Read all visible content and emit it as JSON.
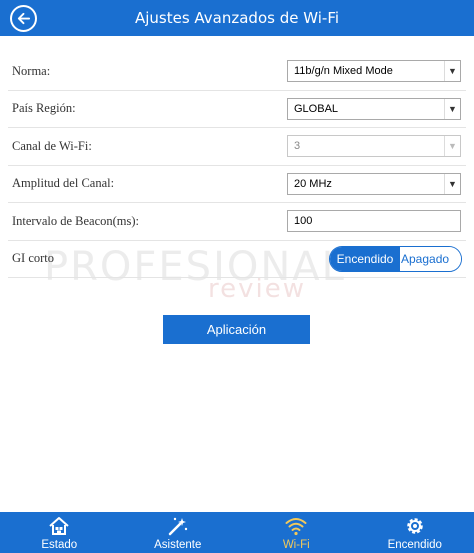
{
  "header": {
    "title": "Ajustes Avanzados de Wi-Fi",
    "back_icon": "back-arrow-icon"
  },
  "form": {
    "mode": {
      "label": "Norma:",
      "value": "11b/g/n Mixed Mode"
    },
    "region": {
      "label": "País Región:",
      "value": "GLOBAL"
    },
    "channel": {
      "label": "Canal de Wi-Fi:",
      "value": "3"
    },
    "bandwidth": {
      "label": "Amplitud del Canal:",
      "value": "20 MHz"
    },
    "beacon": {
      "label": "Intervalo de Beacon(ms):",
      "value": "100"
    },
    "gi": {
      "label": "GI corto",
      "on_label": "Encendido",
      "off_label": "Apagado",
      "selected": "Encendido"
    }
  },
  "watermark": {
    "line1": "PROFESIONAL",
    "line2": "review"
  },
  "apply_label": "Aplicación",
  "nav": {
    "items": [
      {
        "label": "Estado",
        "icon": "home-icon"
      },
      {
        "label": "Asistente",
        "icon": "wand-icon"
      },
      {
        "label": "Wi-Fi",
        "icon": "wifi-icon",
        "active": true
      },
      {
        "label": "Encendido",
        "icon": "gear-icon"
      }
    ]
  },
  "colors": {
    "accent": "#1a6fd0",
    "active_nav": "#f2c95a"
  }
}
